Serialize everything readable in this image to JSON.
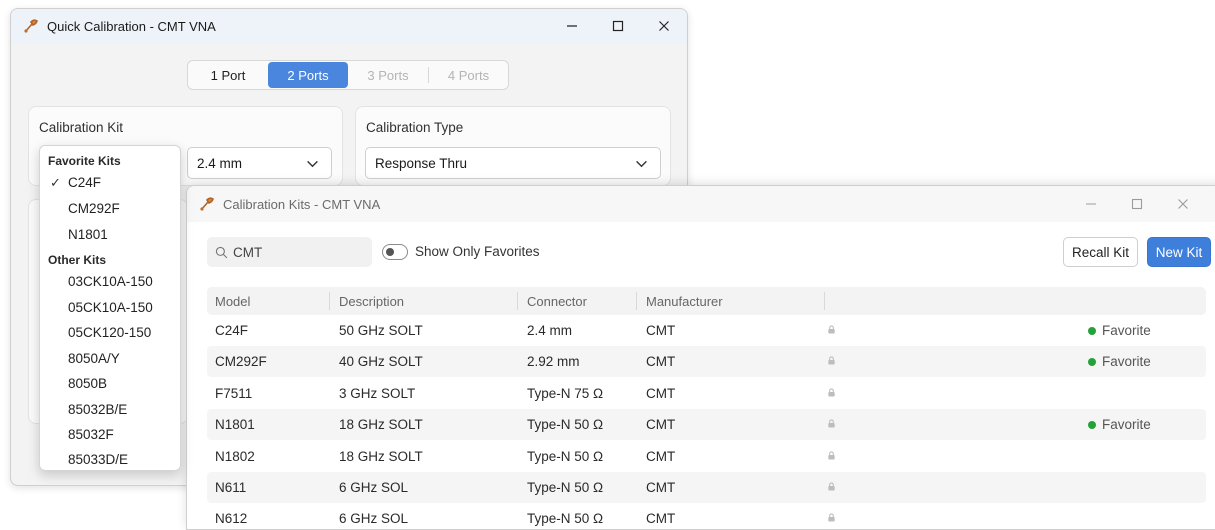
{
  "quick_cal": {
    "title": "Quick Calibration - CMT VNA",
    "ports": [
      {
        "label": "1 Port",
        "state": "normal"
      },
      {
        "label": "2 Ports",
        "state": "active"
      },
      {
        "label": "3 Ports",
        "state": "disabled"
      },
      {
        "label": "4 Ports",
        "state": "disabled"
      }
    ],
    "kit_group_title": "Calibration Kit",
    "connector_value": "2.4 mm",
    "type_group_title": "Calibration Type",
    "type_value": "Response Thru"
  },
  "kit_dropdown": {
    "favorite_header": "Favorite Kits",
    "favorites": [
      "C24F",
      "CM292F",
      "N1801"
    ],
    "selected": "C24F",
    "other_header": "Other Kits",
    "others": [
      "03CK10A-150",
      "05CK10A-150",
      "05CK120-150",
      "8050A/Y",
      "8050B",
      "85032B/E",
      "85032F",
      "85033D/E"
    ]
  },
  "kits_window": {
    "title": "Calibration Kits - CMT VNA",
    "search_value": "CMT",
    "toggle_label": "Show Only Favorites",
    "recall_label": "Recall Kit",
    "new_label": "New Kit",
    "columns": [
      "Model",
      "Description",
      "Connector",
      "Manufacturer"
    ],
    "favorite_text": "Favorite",
    "favorite_color": "#22a33a",
    "rows": [
      {
        "model": "C24F",
        "description": "50 GHz SOLT",
        "connector": "2.4 mm",
        "manufacturer": "CMT",
        "favorite": true
      },
      {
        "model": "CM292F",
        "description": "40 GHz SOLT",
        "connector": "2.92 mm",
        "manufacturer": "CMT",
        "favorite": true
      },
      {
        "model": "F7511",
        "description": "3 GHz SOLT",
        "connector": "Type-N 75 Ω",
        "manufacturer": "CMT",
        "favorite": false
      },
      {
        "model": "N1801",
        "description": "18 GHz SOLT",
        "connector": "Type-N 50 Ω",
        "manufacturer": "CMT",
        "favorite": true
      },
      {
        "model": "N1802",
        "description": "18 GHz SOLT",
        "connector": "Type-N 50 Ω",
        "manufacturer": "CMT",
        "favorite": false
      },
      {
        "model": "N611",
        "description": "6 GHz SOL",
        "connector": "Type-N 50 Ω",
        "manufacturer": "CMT",
        "favorite": false
      },
      {
        "model": "N612",
        "description": "6 GHz SOL",
        "connector": "Type-N 50 Ω",
        "manufacturer": "CMT",
        "favorite": false
      }
    ]
  }
}
